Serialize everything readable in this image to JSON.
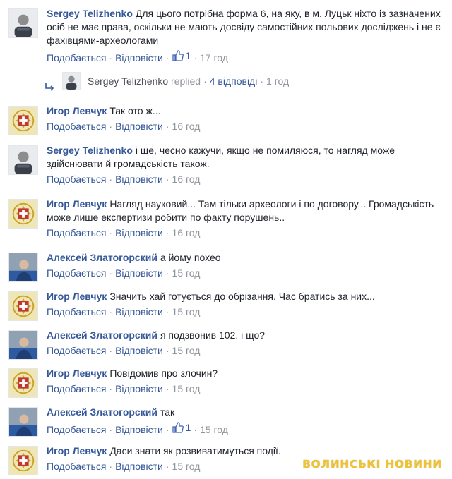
{
  "comments": [
    {
      "author": "Sergey Telizhenko",
      "text": "Для цього потрібна форма 6, на яку, в м. Луцьк ніхто із зазначених осіб не має права, оскільки не мають досвіду самостійних польових досліджень і не є фахівцями-археологами",
      "like_label": "Подобається",
      "reply_label": "Відповісти",
      "likes": "1",
      "time": "17 год",
      "avatar": "photo-avatar-sergey"
    },
    {
      "author": "Игор Левчук",
      "text": "Так ото ж...",
      "like_label": "Подобається",
      "reply_label": "Відповісти",
      "time": "16 год",
      "avatar": "emblem-avatar-igor"
    },
    {
      "author": "Sergey Telizhenko",
      "text": "і ще, чесно кажучи, якщо не помиляюся, то нагляд може здійснювати й громадськість також.",
      "like_label": "Подобається",
      "reply_label": "Відповісти",
      "time": "16 год",
      "avatar": "photo-avatar-sergey"
    },
    {
      "author": "Игор Левчук",
      "text": "Нагляд науковий... Там тільки археологи і по договору... Громадськість може лише експертизи робити по факту порушень..",
      "like_label": "Подобається",
      "reply_label": "Відповісти",
      "time": "16 год",
      "avatar": "emblem-avatar-igor"
    },
    {
      "author": "Алексей Златогорский",
      "text": "а йому похео",
      "like_label": "Подобається",
      "reply_label": "Відповісти",
      "time": "15 год",
      "avatar": "photo-avatar-aleksey"
    },
    {
      "author": "Игор Левчук",
      "text": "Значить хай готується до обрізання. Час братись за них...",
      "like_label": "Подобається",
      "reply_label": "Відповісти",
      "time": "15 год",
      "avatar": "emblem-avatar-igor"
    },
    {
      "author": "Алексей Златогорский",
      "text": "я подзвонив 102. і що?",
      "like_label": "Подобається",
      "reply_label": "Відповісти",
      "time": "15 год",
      "avatar": "photo-avatar-aleksey"
    },
    {
      "author": "Игор Левчук",
      "text": "Повідомив про злочин?",
      "like_label": "Подобається",
      "reply_label": "Відповісти",
      "time": "15 год",
      "avatar": "emblem-avatar-igor"
    },
    {
      "author": "Алексей Златогорский",
      "text": "так",
      "like_label": "Подобається",
      "reply_label": "Відповісти",
      "likes": "1",
      "time": "15 год",
      "avatar": "photo-avatar-aleksey"
    },
    {
      "author": "Игор Левчук",
      "text": "Даси знати як розвиватимуться події.",
      "like_label": "Подобається",
      "reply_label": "Відповісти",
      "time": "15 год",
      "avatar": "emblem-avatar-igor"
    }
  ],
  "reply_summary": {
    "author": "Sergey Telizhenko",
    "action": "replied",
    "count_label": "4 відповіді",
    "time": "1 год"
  },
  "watermark": "ВОЛИНСЬКІ НОВИНИ",
  "colors": {
    "link": "#365899",
    "meta": "#90949c",
    "text": "#1d2129",
    "like_blue": "#4267b2",
    "watermark": "#f1c232"
  }
}
